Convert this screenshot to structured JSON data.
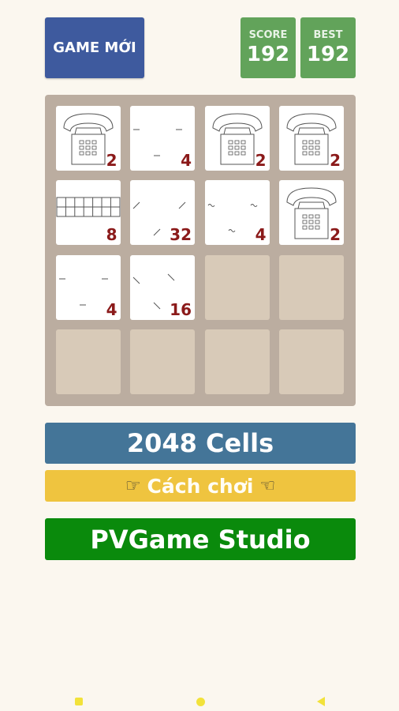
{
  "header": {
    "new_game_label": "GAME MỚI",
    "score_label": "SCORE",
    "score_value": "192",
    "best_label": "BEST",
    "best_value": "192"
  },
  "board": {
    "rows": [
      [
        {
          "value": "2",
          "icon": "telephone-icon"
        },
        {
          "value": "4",
          "icon": "dashes-icon"
        },
        {
          "value": "2",
          "icon": "telephone-icon"
        },
        {
          "value": "2",
          "icon": "telephone-icon"
        }
      ],
      [
        {
          "value": "8",
          "icon": "grid-icon"
        },
        {
          "value": "32",
          "icon": "slashes-icon"
        },
        {
          "value": "4",
          "icon": "tildes-icon"
        },
        {
          "value": "2",
          "icon": "telephone-icon"
        }
      ],
      [
        {
          "value": "4",
          "icon": "dashes-icon"
        },
        {
          "value": "16",
          "icon": "backslashes-icon"
        },
        {
          "value": "",
          "icon": "empty"
        },
        {
          "value": "",
          "icon": "empty"
        }
      ],
      [
        {
          "value": "",
          "icon": "empty"
        },
        {
          "value": "",
          "icon": "empty"
        },
        {
          "value": "",
          "icon": "empty"
        },
        {
          "value": "",
          "icon": "empty"
        }
      ]
    ]
  },
  "menu": {
    "cells_label": "2048 Cells",
    "howto_label": "Cách chơi",
    "howto_left_icon": "pointing-right-hand-icon",
    "howto_right_icon": "pointing-left-hand-icon",
    "studio_label": "PVGame Studio"
  },
  "navbar": {
    "items": [
      "recent-apps-icon",
      "home-icon",
      "back-icon"
    ]
  },
  "colors": {
    "background": "#fbf7ef",
    "new_game": "#3e5a9e",
    "score_box": "#62a35a",
    "board": "#bbada0",
    "empty_cell": "#d8cab8",
    "tile_number": "#8b1a1a",
    "cells_button": "#447598",
    "howto_button": "#efc43f",
    "studio_button": "#0a8a0c",
    "nav_icons": "#f2e23a"
  }
}
